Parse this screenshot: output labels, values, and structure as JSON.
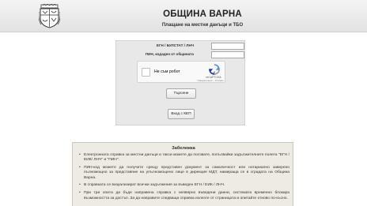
{
  "header": {
    "title": "ОБЩИНА ВАРНА",
    "subtitle": "Плащане на местни данъци и ТБО",
    "crest_icon": "varna-coat-of-arms"
  },
  "form": {
    "egn_label": "ЕГН / БУЛСТАТ / ЛНЧ",
    "egn_value": "",
    "pin_label": "ПИН, издаден от общината",
    "pin_value": ""
  },
  "recaptcha": {
    "label": "Не съм робот",
    "brand": "reCAPTCHA",
    "terms": "Поверителност - Условия"
  },
  "buttons": {
    "search": "Търсене",
    "kep": "Вход с КЕП"
  },
  "notes": {
    "title": "Забележка",
    "items": [
      "Електронната справка за местни данъци и такси можете да ползвате, попълвайки задължителните полета \"ЕГН / ЕИК/ ЛНЧ\" и \"ПИН\".",
      "ПИН-код можете да получите срещу представен документ за самоличност или нотариално заверено пълномощно за представяне на упълномощено лице в дирекция МДТ, намираща се в сградата на Община Варна.",
      "В справката се визуализират всички задължения за въведен ЕГН / ЕИК / ЛНЧ.",
      "При три опита да бъде направена справка с неявярно въведени данни, системата временно блокира възможността за достъп. За да направите следваща справка излезте от страницата и опитайте отново по-късно."
    ]
  }
}
